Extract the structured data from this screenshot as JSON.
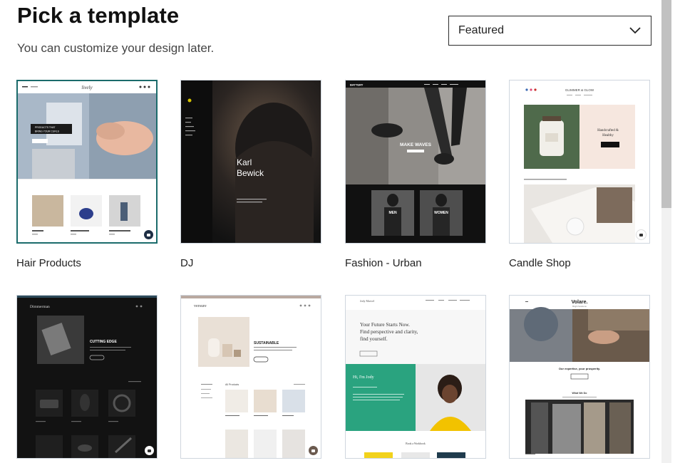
{
  "header": {
    "title": "Pick a template",
    "subtitle": "You can customize your design later."
  },
  "sort": {
    "selected": "Featured"
  },
  "templates": [
    {
      "label": "Hair Products",
      "selected": true,
      "preview": {
        "brand": "lively",
        "hero_text": "PRODUCTS THAT BRING YOUR CURLS TO LIFE",
        "hero_button": "SHOP NOW"
      }
    },
    {
      "label": "DJ",
      "selected": false,
      "preview": {
        "name_line1": "Karl",
        "name_line2": "Bewick"
      }
    },
    {
      "label": "Fashion - Urban",
      "selected": false,
      "preview": {
        "brand": "BATTERY",
        "hero_text": "MAKE WAVES",
        "men_label": "MEN",
        "women_label": "WOMEN"
      }
    },
    {
      "label": "Candle Shop",
      "selected": false,
      "preview": {
        "brand": "GLIMMER & GLOW",
        "hero_text": "Handcrafted & Healthy",
        "hero_button": "SHOP NOW"
      }
    },
    {
      "label": "",
      "selected": false,
      "preview": {
        "brand": "Dimmerman",
        "hero_text": "CUTTING EDGE"
      }
    },
    {
      "label": "",
      "selected": false,
      "preview": {
        "brand": "versure",
        "hero_text": "SUSTAINABLE",
        "section_title": "All Products"
      }
    },
    {
      "label": "",
      "selected": false,
      "preview": {
        "brand": "Jody Marvel",
        "hero_text": "Your Future Starts Now. Find perspective and clarity, find yourself.",
        "greeting": "Hi, I'm Jody",
        "section_title": "Book a Workbook"
      }
    },
    {
      "label": "",
      "selected": false,
      "preview": {
        "brand": "Volare.",
        "tagline": "Bright Solutions",
        "hero_text": "Our expertise, your prosperity.",
        "section_title": "What We Do"
      }
    }
  ],
  "colors": {
    "accent_teal": "#1b6b6b",
    "green_panel": "#2aa37f",
    "dark": "#1a1a1a"
  }
}
